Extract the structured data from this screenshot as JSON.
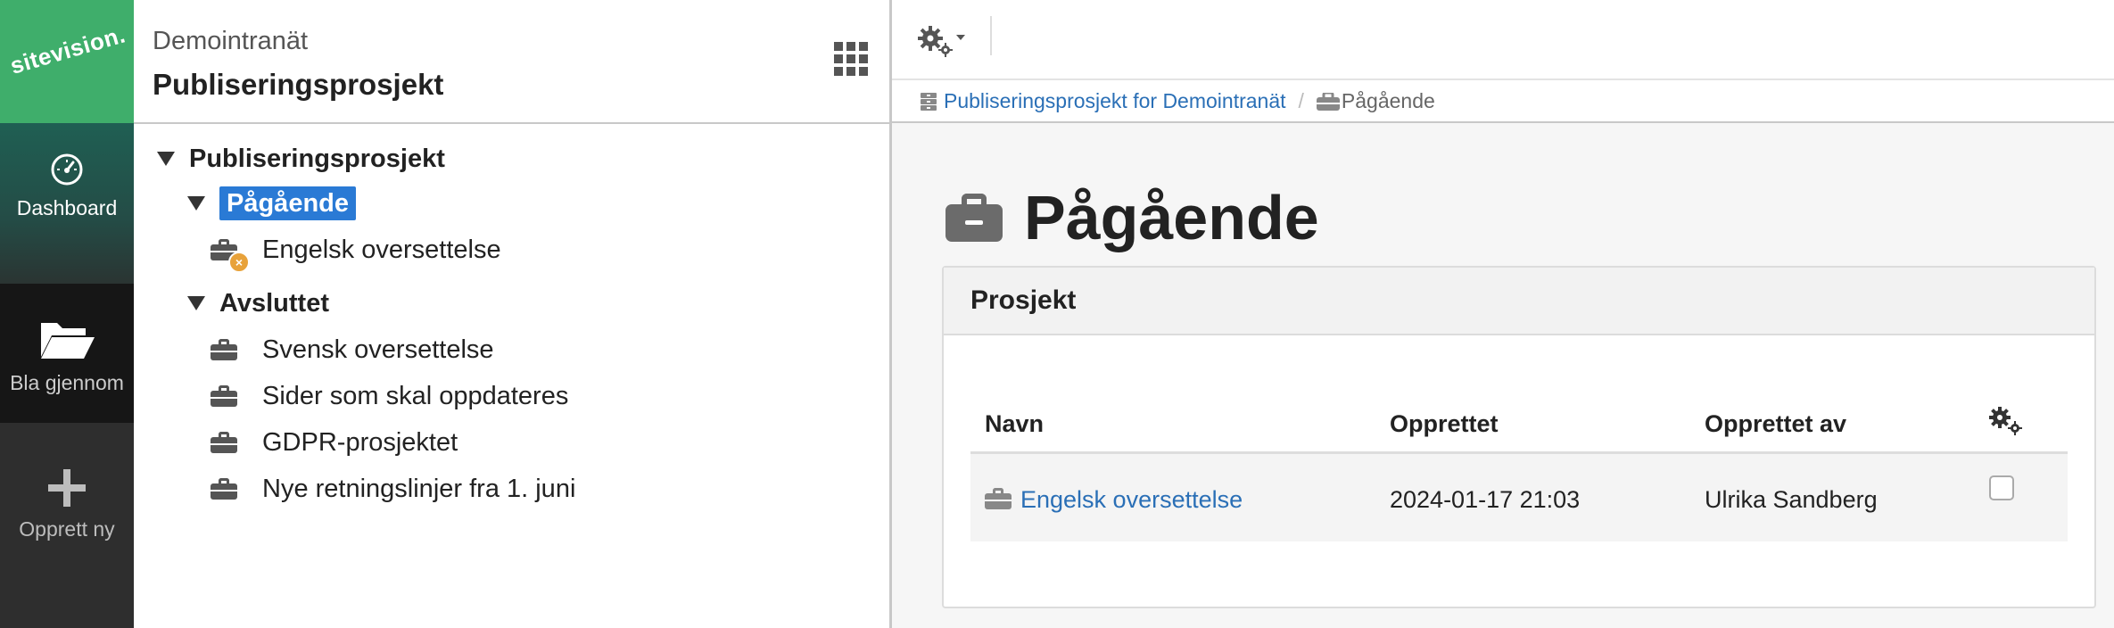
{
  "brand": {
    "logo_text": "sitevision."
  },
  "rail": {
    "dashboard_label": "Dashboard",
    "browse_label": "Bla gjennom",
    "create_label": "Opprett ny"
  },
  "tree_panel": {
    "site_name": "Demointranät",
    "title": "Publiseringsprosjekt"
  },
  "tree": {
    "root": "Publiseringsprosjekt",
    "ongoing": "Pågående",
    "ongoing_items": [
      "Engelsk oversettelse"
    ],
    "finished": "Avsluttet",
    "finished_items": [
      "Svensk oversettelse",
      "Sider som skal oppdateres",
      "GDPR-prosjektet",
      "Nye retningslinjer fra 1. juni"
    ]
  },
  "breadcrumb": {
    "parent": "Publiseringsprosjekt for Demointranät",
    "separator": "/",
    "current": "Pågående"
  },
  "page": {
    "heading": "Pågående",
    "panel_title": "Prosjekt"
  },
  "table": {
    "headers": {
      "name": "Navn",
      "created": "Opprettet",
      "created_by": "Opprettet av"
    },
    "rows": [
      {
        "name": "Engelsk oversettelse",
        "created": "2024-01-17 21:03",
        "created_by": "Ulrika Sandberg"
      }
    ]
  },
  "colors": {
    "brand_green": "#3fae6b",
    "selection_blue": "#2a7ad5",
    "link_blue": "#2a6fb6",
    "badge_orange": "#e8a23a"
  }
}
